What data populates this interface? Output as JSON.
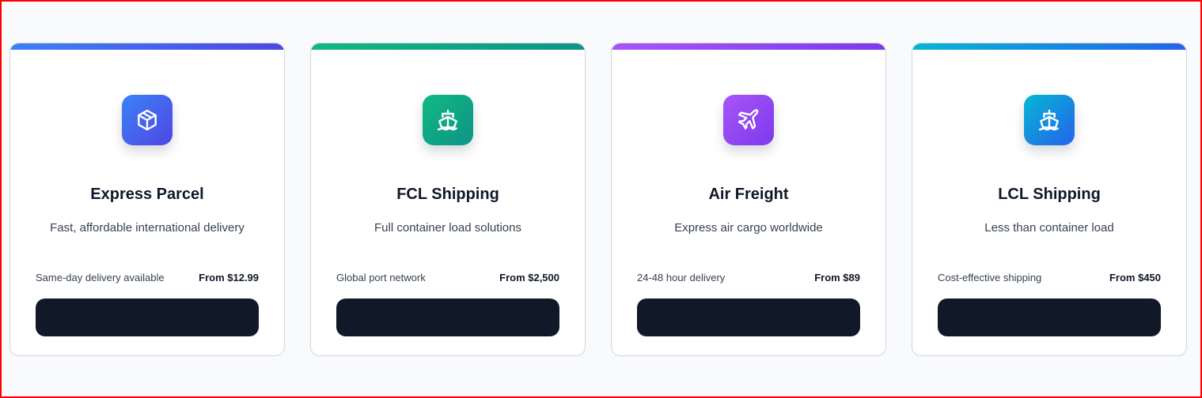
{
  "services": [
    {
      "id": "express-parcel",
      "title": "Express Parcel",
      "description": "Fast, affordable international delivery",
      "feature": "Same-day delivery available",
      "price": "From $12.99",
      "button_label": "",
      "icon": "package-icon",
      "gradient": [
        "#3b82f6",
        "#4f46e5"
      ]
    },
    {
      "id": "fcl-shipping",
      "title": "FCL Shipping",
      "description": "Full container load solutions",
      "feature": "Global port network",
      "price": "From $2,500",
      "button_label": "",
      "icon": "ship-icon",
      "gradient": [
        "#10b981",
        "#0d9488"
      ]
    },
    {
      "id": "air-freight",
      "title": "Air Freight",
      "description": "Express air cargo worldwide",
      "feature": "24-48 hour delivery",
      "price": "From $89",
      "button_label": "",
      "icon": "plane-icon",
      "gradient": [
        "#a855f7",
        "#7c3aed"
      ]
    },
    {
      "id": "lcl-shipping",
      "title": "LCL Shipping",
      "description": "Less than container load",
      "feature": "Cost-effective shipping",
      "price": "From $450",
      "button_label": "",
      "icon": "ship-icon",
      "gradient": [
        "#06b6d4",
        "#2563eb"
      ]
    }
  ],
  "colors": {
    "page_background": "#f8fafc",
    "card_border": "#d1d5db",
    "button_background": "#111827",
    "title_text": "#0f172a"
  }
}
